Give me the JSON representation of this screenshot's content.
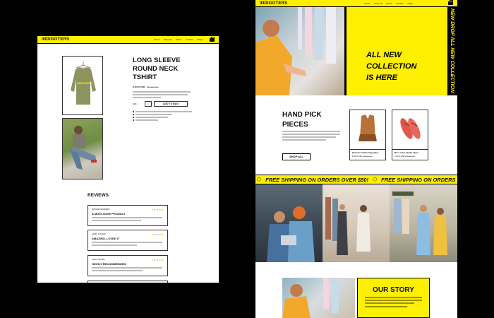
{
  "left": {
    "brand": "INDIGOTERS",
    "nav": [
      "Home",
      "Shop All",
      "About",
      "Contact",
      "FAQs"
    ],
    "product": {
      "title_lines": [
        "LONG SLEEVE",
        "ROUND NECK",
        "TSHIRT"
      ],
      "price": "$ 30.00 USD",
      "old_price": "$40.00 USD",
      "size_label": "SIZE",
      "qty": "1",
      "add_button": "ADD TO BAG",
      "shirt_print": "INDIGOTERS"
    },
    "reviews_title": "REVIEWS",
    "reviews": [
      {
        "author": "FRANCES EDWARDS",
        "headline": "A MUST-HAVE PRODUCT",
        "stars": "★★★★★"
      },
      {
        "author": "LARRY LOGSON",
        "headline": "AMAZING, LOVED IT",
        "stars": "★★★★★"
      },
      {
        "author": "LORI STIGGINS",
        "headline": "HIGHLY RECOMMENDED!",
        "stars": "★★★★★"
      }
    ]
  },
  "right": {
    "brand": "INDIGOTERS",
    "nav": [
      "Home",
      "Shop All",
      "About",
      "Contact",
      "FAQs"
    ],
    "hero_lines": [
      "ALL NEW",
      "COLLECTION",
      "IS HERE"
    ],
    "ticker_vertical": "NEW DROP ALL NEW COLLECTION",
    "hand_pick_lines": [
      "HAND PICK",
      "PIECES"
    ],
    "shop_all": "SHOP ALL",
    "products": [
      {
        "name": "Sleeveless leather fringe jacket",
        "price": "$ 45.00 USD",
        "old": "$70.00 USD"
      },
      {
        "name": "Men's cotton friendly slipper",
        "price": "$ 45.00 USD",
        "old": "$50.00 USD"
      }
    ],
    "shipping_banner": "FREE SHIPPING ON ORDERS OVER $50!",
    "shipping_banner_2": "FREE SHIPPING ON ORDERS OV",
    "our_story": "OUR STORY"
  }
}
